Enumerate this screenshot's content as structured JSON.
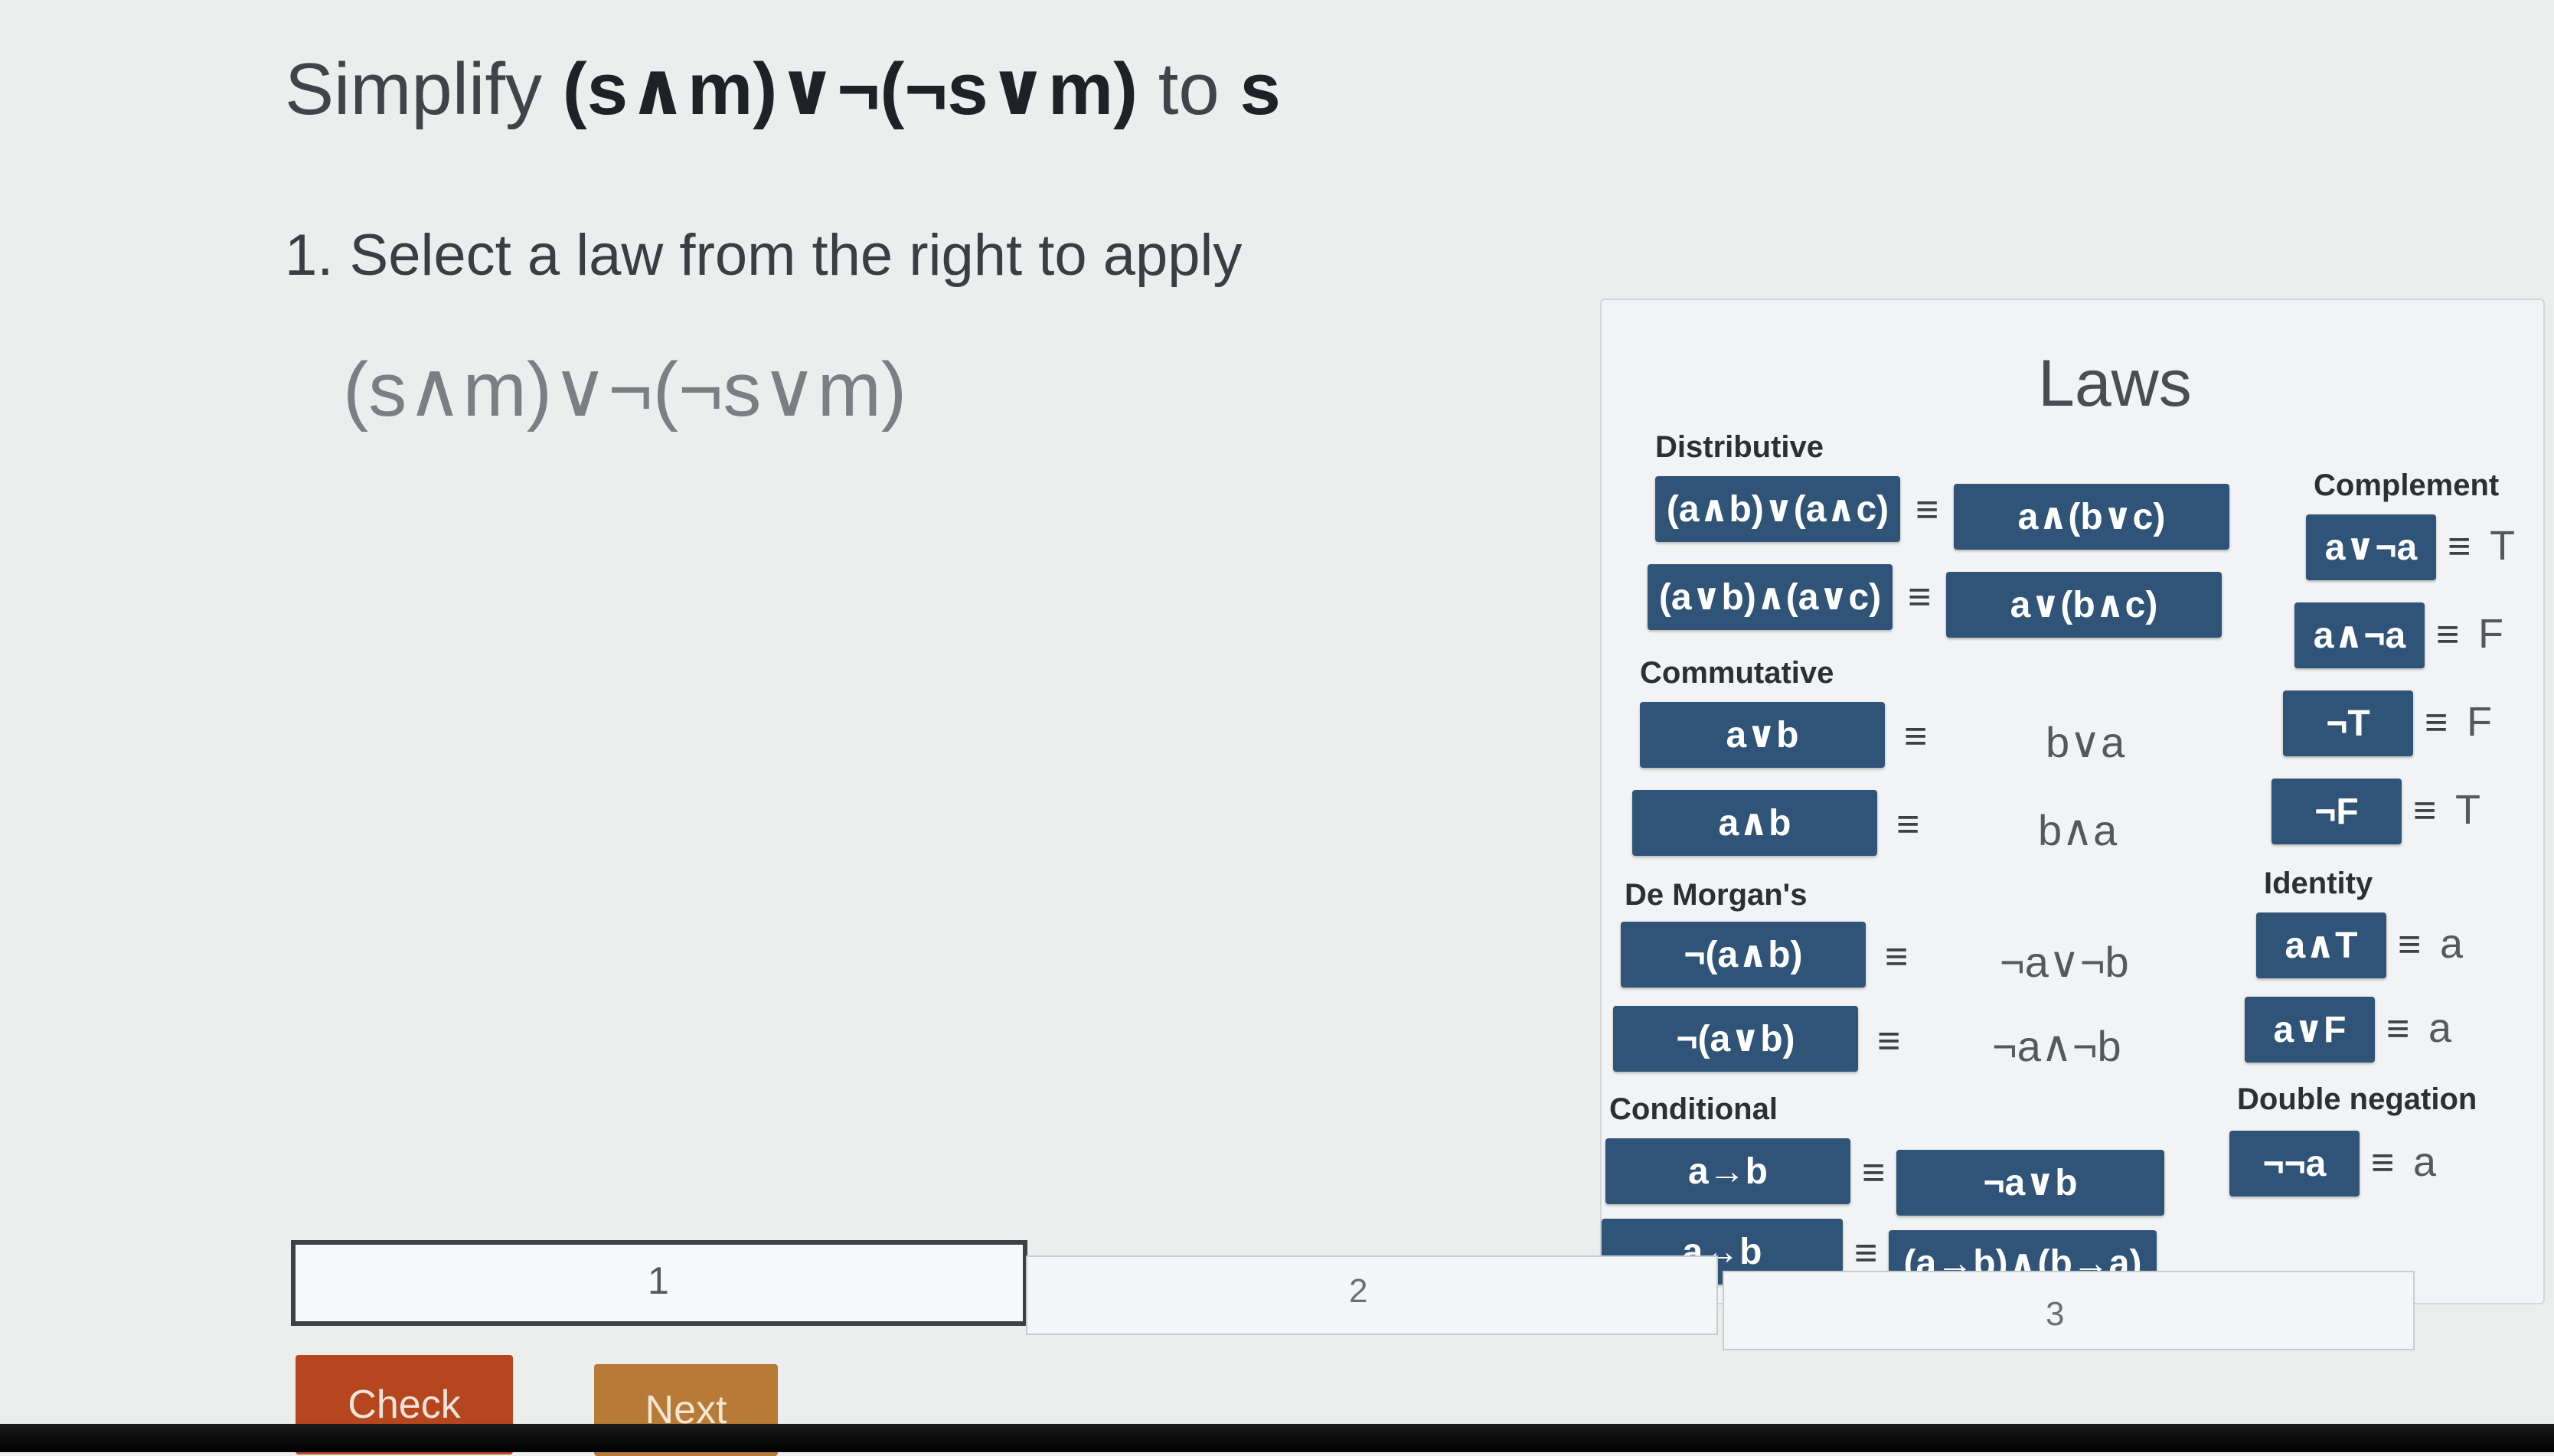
{
  "problem": {
    "prefix": "Simplify",
    "expression": "(s∧m)∨¬(¬s∨m)",
    "middle": "to",
    "target": "s"
  },
  "step": {
    "number": "1.",
    "instruction": "Select a law from the right to apply",
    "current_expression": "(s∧m)∨¬(¬s∨m)"
  },
  "laws": {
    "title": "Laws",
    "equiv_symbol": "≡",
    "distributive": {
      "label": "Distributive",
      "rows": [
        {
          "lhs": "(a∧b)∨(a∧c)",
          "rhs": "a∧(b∨c)"
        },
        {
          "lhs": "(a∨b)∧(a∨c)",
          "rhs": "a∨(b∧c)"
        }
      ]
    },
    "commutative": {
      "label": "Commutative",
      "rows": [
        {
          "lhs": "a∨b",
          "rhs": "b∨a"
        },
        {
          "lhs": "a∧b",
          "rhs": "b∧a"
        }
      ]
    },
    "demorgan": {
      "label": "De Morgan's",
      "rows": [
        {
          "lhs": "¬(a∧b)",
          "rhs": "¬a∨¬b"
        },
        {
          "lhs": "¬(a∨b)",
          "rhs": "¬a∧¬b"
        }
      ]
    },
    "conditional": {
      "label": "Conditional",
      "rows": [
        {
          "lhs": "a→b",
          "rhs": "¬a∨b"
        },
        {
          "lhs": "a↔b",
          "rhs": "(a→b)∧(b→a)"
        }
      ]
    },
    "complement": {
      "label": "Complement",
      "rows": [
        {
          "lhs": "a∨¬a",
          "rhs": "T"
        },
        {
          "lhs": "a∧¬a",
          "rhs": "F"
        },
        {
          "lhs": "¬T",
          "rhs": "F"
        },
        {
          "lhs": "¬F",
          "rhs": "T"
        }
      ]
    },
    "identity": {
      "label": "Identity",
      "rows": [
        {
          "lhs": "a∧T",
          "rhs": "a"
        },
        {
          "lhs": "a∨F",
          "rhs": "a"
        }
      ]
    },
    "double_negation": {
      "label": "Double negation",
      "rows": [
        {
          "lhs": "¬¬a",
          "rhs": "a"
        }
      ]
    }
  },
  "progress": {
    "segments": [
      "1",
      "2",
      "3"
    ],
    "current": 1
  },
  "buttons": {
    "check": "Check",
    "next": "Next"
  },
  "colors": {
    "law_button": "#2f5478",
    "check_button": "#b5461e",
    "next_button": "#b77a37"
  }
}
